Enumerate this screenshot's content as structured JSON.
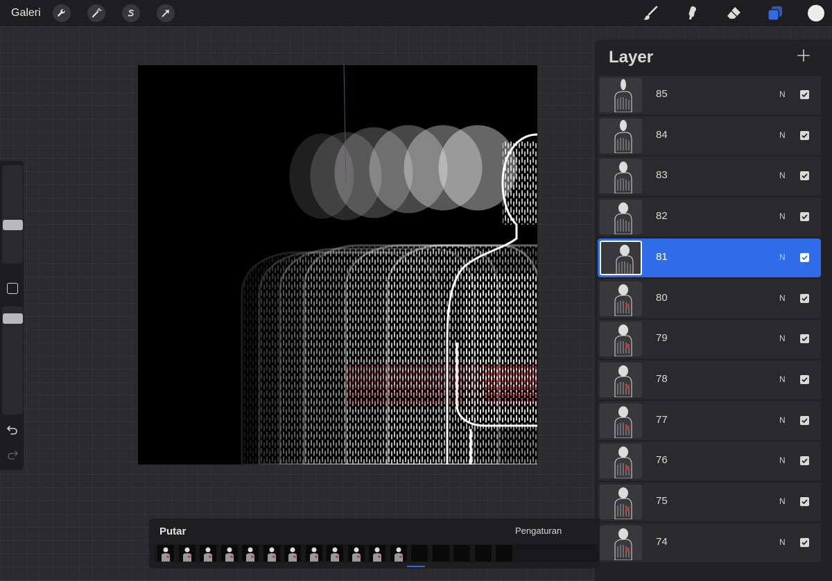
{
  "topbar": {
    "gallery_label": "Galeri",
    "left_tools": [
      "wrench-icon",
      "magic-wand-icon",
      "selection-s-icon",
      "transform-arrow-icon"
    ],
    "right_tools": [
      "brush-icon",
      "smudge-icon",
      "eraser-icon",
      "layers-icon"
    ],
    "active_color": "#ececec",
    "accent_color": "#2f6de8"
  },
  "sidebar": {
    "tools": [
      "brush-size-slider",
      "modify-button",
      "opacity-slider",
      "undo-icon",
      "redo-icon"
    ]
  },
  "layers": {
    "title": "Layer",
    "add_icon": "plus-icon",
    "items": [
      {
        "name": "85",
        "blend": "N",
        "visible": true,
        "selected": false
      },
      {
        "name": "84",
        "blend": "N",
        "visible": true,
        "selected": false
      },
      {
        "name": "83",
        "blend": "N",
        "visible": true,
        "selected": false
      },
      {
        "name": "82",
        "blend": "N",
        "visible": true,
        "selected": false
      },
      {
        "name": "81",
        "blend": "N",
        "visible": true,
        "selected": true
      },
      {
        "name": "80",
        "blend": "N",
        "visible": true,
        "selected": false
      },
      {
        "name": "79",
        "blend": "N",
        "visible": true,
        "selected": false
      },
      {
        "name": "78",
        "blend": "N",
        "visible": true,
        "selected": false
      },
      {
        "name": "77",
        "blend": "N",
        "visible": true,
        "selected": false
      },
      {
        "name": "76",
        "blend": "N",
        "visible": true,
        "selected": false
      },
      {
        "name": "75",
        "blend": "N",
        "visible": true,
        "selected": false
      },
      {
        "name": "74",
        "blend": "N",
        "visible": true,
        "selected": false
      }
    ]
  },
  "animation": {
    "play_label": "Putar",
    "settings_label": "Pengaturan",
    "frame_count": 17
  }
}
